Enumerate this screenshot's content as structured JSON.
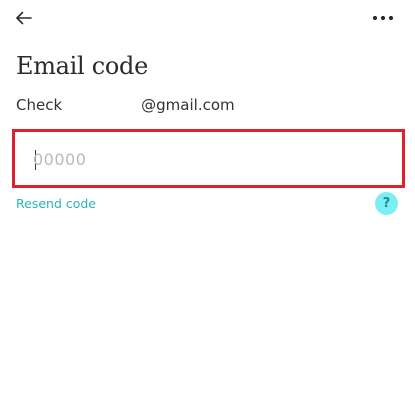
{
  "header": {
    "back_icon": "arrow-left-icon",
    "more_icon": "more-horizontal-icon"
  },
  "title": "Email code",
  "instruction": {
    "prefix": "Check",
    "email_suffix": "@gmail.com"
  },
  "code_input": {
    "placeholder": "00000",
    "value": ""
  },
  "resend_label": "Resend code",
  "help_label": "?",
  "colors": {
    "accent": "#2cb3b9",
    "help_bg": "#7af0f4",
    "highlight_border": "#e0202c",
    "text": "#2b2b2b"
  }
}
